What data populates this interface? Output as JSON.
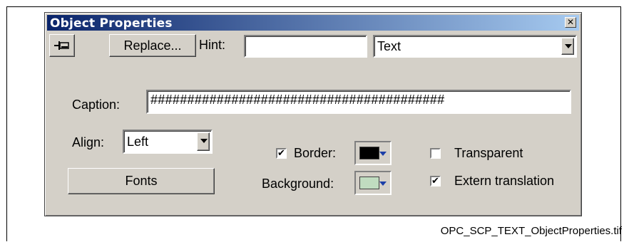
{
  "dialog": {
    "title": "Object Properties",
    "close_glyph": "✕",
    "pin_icon": "pin-icon",
    "replace_label": "Replace...",
    "hint_label": "Hint:",
    "hint_value": "",
    "type_selected": "Text",
    "caption_label": "Caption:",
    "caption_value": "########################################",
    "align_label": "Align:",
    "align_selected": "Left",
    "fonts_label": "Fonts",
    "border_label": "Border:",
    "border_checked": true,
    "border_color": "#000000",
    "background_label": "Background:",
    "background_color": "#c0dcc0",
    "transparent_label": "Transparent",
    "transparent_checked": false,
    "extern_label": "Extern translation",
    "extern_checked": true,
    "check_glyph": "✔"
  },
  "figure_caption": "OPC_SCP_TEXT_ObjectProperties.tif"
}
